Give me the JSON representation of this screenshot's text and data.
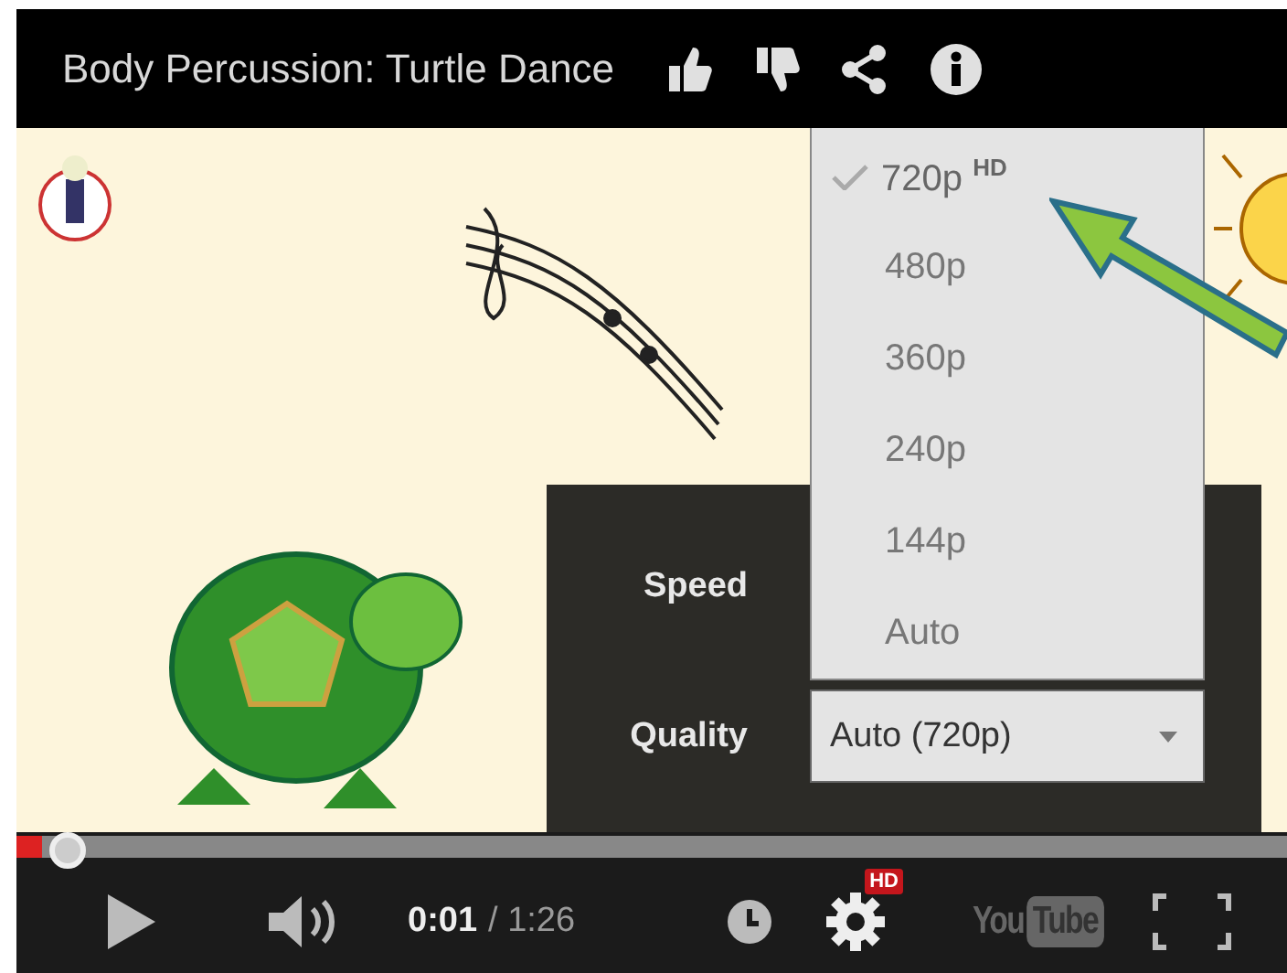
{
  "player": {
    "title": "Body Percussion: Turtle Dance"
  },
  "settings": {
    "speed_label": "Speed",
    "quality_label": "Quality",
    "quality_value": "Auto (720p)"
  },
  "quality_menu": [
    {
      "label": "720p $^{HD}$",
      "selected": true
    },
    {
      "label": "480p",
      "selected": false
    },
    {
      "label": "360p",
      "selected": false
    },
    {
      "label": "240p",
      "selected": false
    },
    {
      "label": "144p",
      "selected": false
    },
    {
      "label": "Auto",
      "selected": false
    }
  ],
  "progress": {
    "level": 0.02
  },
  "controls": {
    "current_time": "0:01",
    "duration": "/ 1:26",
    "hd_badge": "HD",
    "logo_left": "You",
    "logo_right": "Tube"
  }
}
